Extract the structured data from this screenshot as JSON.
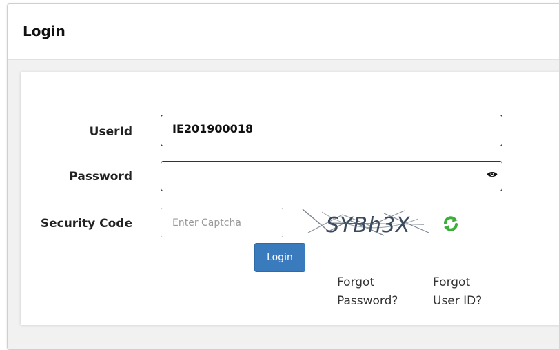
{
  "header": {
    "title": "Login"
  },
  "form": {
    "userid_label": "UserId",
    "userid_value": "IE201900018",
    "password_label": "Password",
    "password_value": "",
    "security_label": "Security Code",
    "captcha_placeholder": "Enter Captcha",
    "captcha_text": "SYBh3X",
    "login_button": "Login"
  },
  "links": {
    "forgot_password_line1": "Forgot",
    "forgot_password_line2": "Password?",
    "forgot_userid_line1": "Forgot",
    "forgot_userid_line2": "User ID?"
  },
  "icons": {
    "password_toggle": "eye-icon",
    "captcha_refresh": "refresh-icon"
  },
  "colors": {
    "button_bg": "#3a7bbd",
    "refresh_green": "#3cae3a"
  }
}
